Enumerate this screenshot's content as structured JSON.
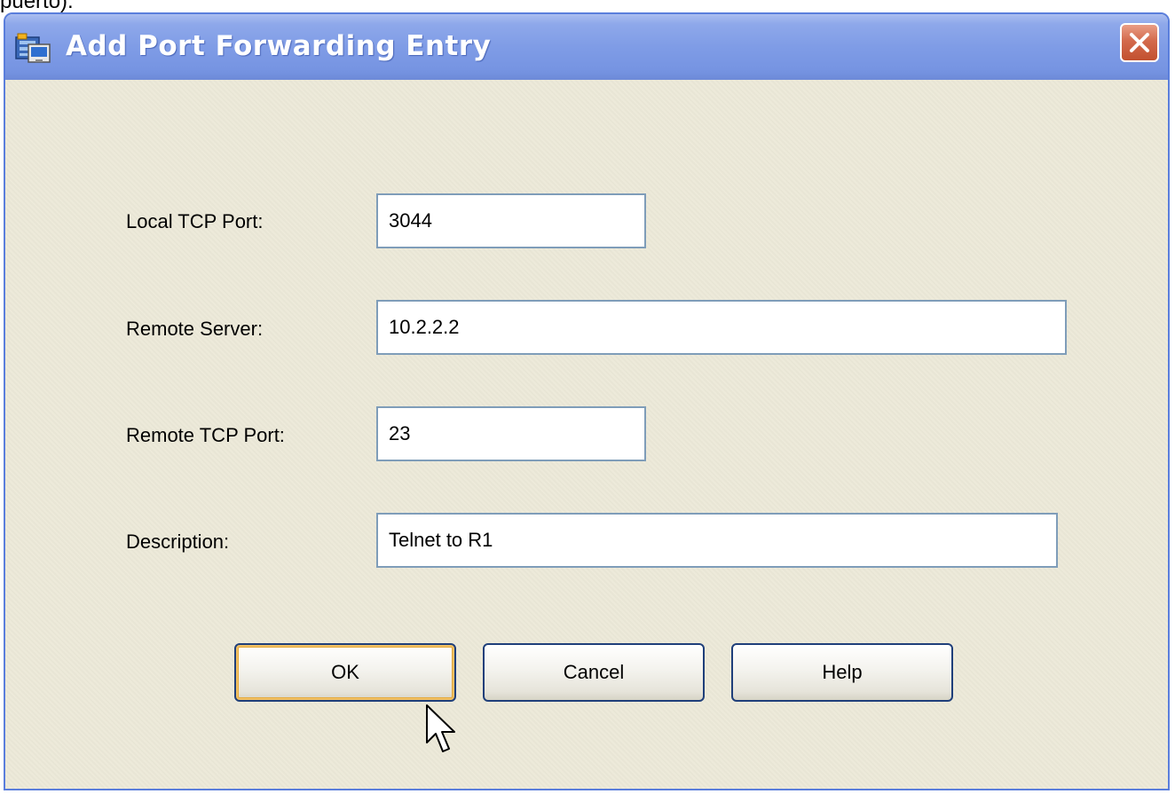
{
  "caption_fragment": "puerto).",
  "dialog": {
    "title": "Add Port Forwarding Entry",
    "fields": {
      "local_tcp_port": {
        "label": "Local TCP Port:",
        "value": "3044"
      },
      "remote_server": {
        "label": "Remote Server:",
        "value": "10.2.2.2"
      },
      "remote_tcp_port": {
        "label": "Remote TCP Port:",
        "value": "23"
      },
      "description": {
        "label": "Description:",
        "value": "Telnet to R1"
      }
    },
    "buttons": {
      "ok": "OK",
      "cancel": "Cancel",
      "help": "Help"
    }
  },
  "colors": {
    "titlebar": "#7f9ce6",
    "dialog_background": "#ece9d8",
    "close_button": "#d36a4c",
    "field_border": "#7f9db9",
    "default_button_highlight": "#f0c064"
  },
  "icons": {
    "app": "port-forwarding-icon",
    "close": "close-icon",
    "cursor": "mouse-pointer-icon"
  }
}
